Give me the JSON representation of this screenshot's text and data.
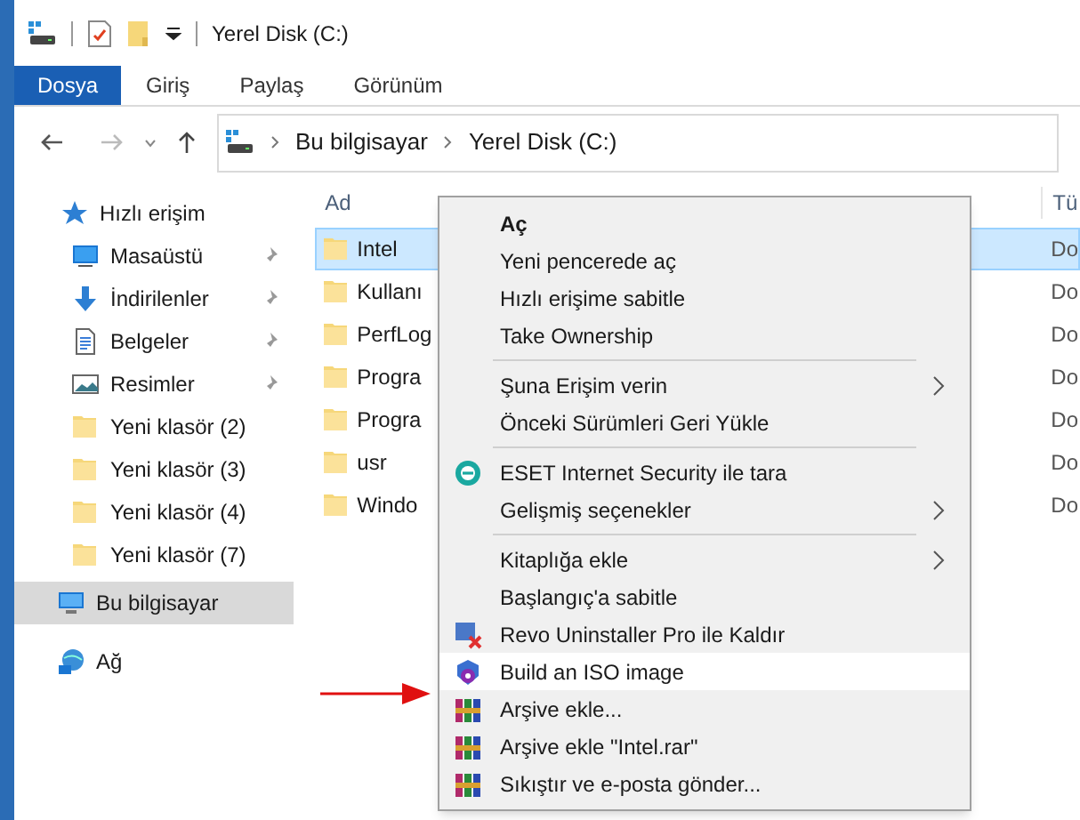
{
  "window": {
    "title": "Yerel Disk (C:)"
  },
  "ribbon_tabs": [
    {
      "label": "Dosya",
      "selected": true
    },
    {
      "label": "Giriş",
      "selected": false
    },
    {
      "label": "Paylaş",
      "selected": false
    },
    {
      "label": "Görünüm",
      "selected": false
    }
  ],
  "address_bar": {
    "path": [
      "Bu bilgisayar",
      "Yerel Disk (C:)"
    ]
  },
  "nav_pane": {
    "items": [
      {
        "label": "Hızlı erişim",
        "kind": "star",
        "selected": false,
        "children": [
          {
            "label": "Masaüstü",
            "kind": "desktop",
            "pinned": true,
            "selected": false
          },
          {
            "label": "İndirilenler",
            "kind": "download",
            "pinned": true,
            "selected": false
          },
          {
            "label": "Belgeler",
            "kind": "docs",
            "pinned": true,
            "selected": false
          },
          {
            "label": "Resimler",
            "kind": "pictures",
            "pinned": true,
            "selected": false
          },
          {
            "label": "Yeni klasör (2)",
            "kind": "folder",
            "pinned": false,
            "selected": false
          },
          {
            "label": "Yeni klasör (3)",
            "kind": "folder",
            "pinned": false,
            "selected": false
          },
          {
            "label": "Yeni klasör (4)",
            "kind": "folder",
            "pinned": false,
            "selected": false
          },
          {
            "label": "Yeni klasör (7)",
            "kind": "folder",
            "pinned": false,
            "selected": false
          }
        ]
      },
      {
        "label": "Bu bilgisayar",
        "kind": "pc",
        "selected": true
      },
      {
        "label": "Ağ",
        "kind": "network",
        "selected": false
      }
    ]
  },
  "file_list": {
    "columns": [
      "Ad",
      "Tü"
    ],
    "rows": [
      {
        "name": "Intel",
        "type": "Do",
        "selected": true
      },
      {
        "name": "Kullanı",
        "type": "Do",
        "selected": false
      },
      {
        "name": "PerfLog",
        "type": "Do",
        "selected": false
      },
      {
        "name": "Progra",
        "type": "Do",
        "selected": false
      },
      {
        "name": "Progra",
        "type": "Do",
        "selected": false
      },
      {
        "name": "usr",
        "type": "Do",
        "selected": false
      },
      {
        "name": "Windo",
        "type": "Do",
        "selected": false
      }
    ]
  },
  "context_menu": {
    "items": [
      {
        "kind": "plain",
        "label": "Aç",
        "bold": true
      },
      {
        "kind": "plain",
        "label": "Yeni pencerede aç",
        "bold": false
      },
      {
        "kind": "plain",
        "label": "Hızlı erişime sabitle",
        "bold": false
      },
      {
        "kind": "plain",
        "label": "Take Ownership",
        "bold": false
      },
      {
        "kind": "separator"
      },
      {
        "kind": "plain",
        "label": "Şuna Erişim verin",
        "submenu": true
      },
      {
        "kind": "plain",
        "label": "Önceki Sürümleri Geri Yükle"
      },
      {
        "kind": "separator"
      },
      {
        "kind": "shield",
        "label": "ESET Internet Security ile tara"
      },
      {
        "kind": "plain",
        "label": "Gelişmiş seçenekler",
        "submenu": true
      },
      {
        "kind": "separator"
      },
      {
        "kind": "plain",
        "label": "Kitaplığa ekle",
        "submenu": true
      },
      {
        "kind": "plain",
        "label": "Başlangıç'a sabitle"
      },
      {
        "kind": "uninstall",
        "label": "Revo Uninstaller Pro ile Kaldır"
      },
      {
        "kind": "disc",
        "label": "Build an ISO image",
        "highlighted": true
      },
      {
        "kind": "archive",
        "label": "Arşive ekle..."
      },
      {
        "kind": "archive",
        "label": "Arşive ekle \"Intel.rar\""
      },
      {
        "kind": "archive",
        "label": "Sıkıştır ve e-posta gönder..."
      }
    ]
  }
}
